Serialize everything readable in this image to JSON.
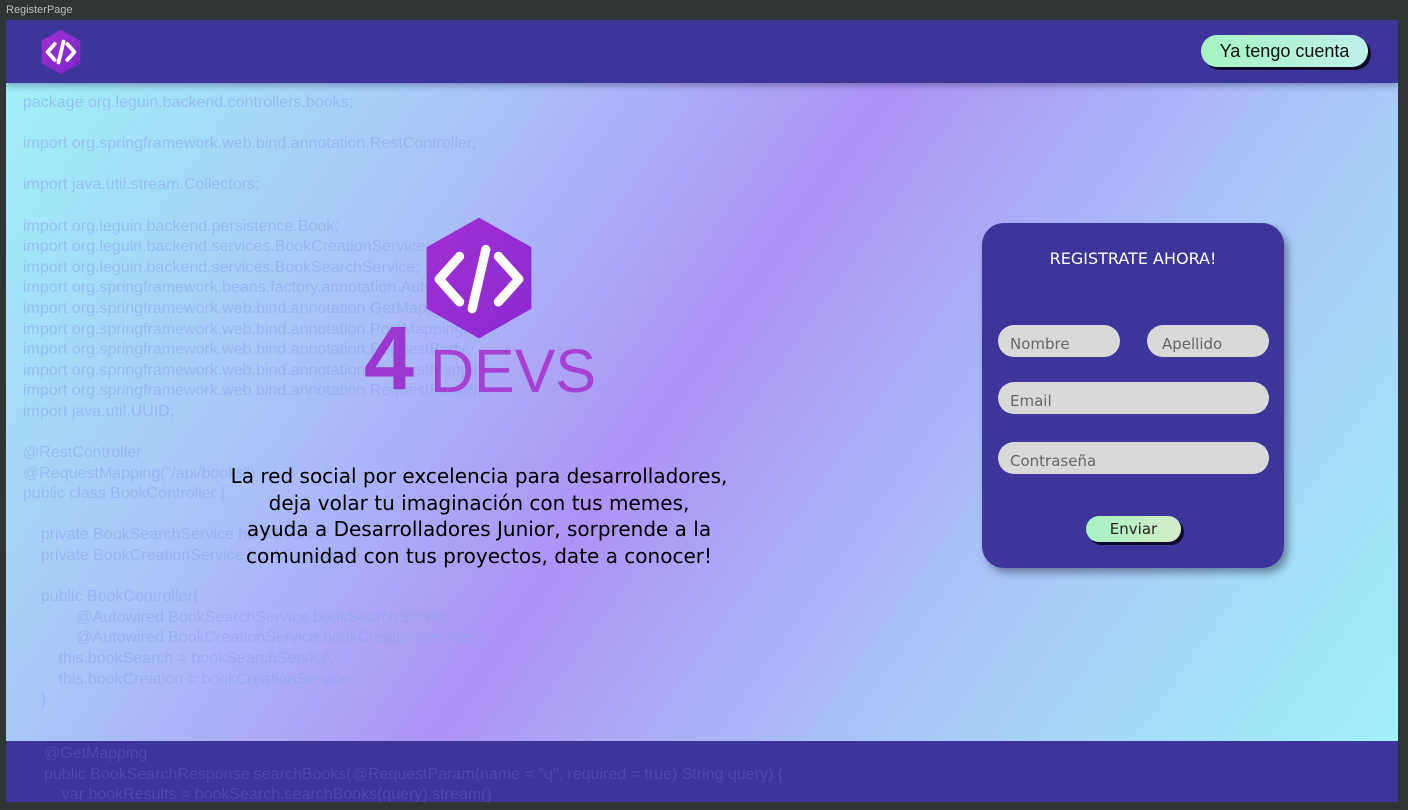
{
  "window": {
    "title": "RegisterPage"
  },
  "header": {
    "logo_icon": "code-tag-icon",
    "have_account_label": "Ya tengo cuenta"
  },
  "background_code": "package org.leguin.backend.controllers.books;\n\nimport org.springframework.web.bind.annotation.RestController;\n\nimport java.util.stream.Collectors;\n\nimport org.leguin.backend.persistence.Book;\nimport org.leguin.backend.services.BookCreationService;\nimport org.leguin.backend.services.BookSearchService;\nimport org.springframework.beans.factory.annotation.Autowired;\nimport org.springframework.web.bind.annotation.GetMapping;\nimport org.springframework.web.bind.annotation.PostMapping;\nimport org.springframework.web.bind.annotation.RequestBody;\nimport org.springframework.web.bind.annotation.RequestMapping;\nimport org.springframework.web.bind.annotation.RequestParam;\nimport java.util.UUID;\n\n@RestController\n@RequestMapping(\"/api/books\")\npublic class BookController {\n\n    private BookSearchService bookSearch;\n    private BookCreationService bookCreation;\n\n    public BookController(\n            @Autowired BookSearchService bookSearchService,\n            @Autowired BookCreationService bookCreationService) {\n        this.bookSearch = bookSearchService;\n        this.bookCreation = bookCreationService;\n    }",
  "footer_code": "@GetMapping\npublic BookSearchResponse searchBooks(@RequestParam(name = \"q\", required = true) String query) {\n    var bookResults = bookSearch.searchBooks(query).stream()",
  "hero": {
    "logo_icon": "code-tag-icon",
    "brand_number": "4",
    "brand_word": "DEVS",
    "tagline": [
      "La red social por excelencia para desarrolladores,",
      "deja volar tu imaginación con tus memes,",
      "ayuda a Desarrolladores Junior, sorprende a la",
      "comunidad con tus proyectos, date a conocer!"
    ]
  },
  "register": {
    "title": "REGISTRATE AHORA!",
    "first_name_placeholder": "Nombre",
    "last_name_placeholder": "Apellido",
    "email_placeholder": "Email",
    "password_placeholder": "Contraseña",
    "submit_label": "Enviar"
  },
  "colors": {
    "header": "#3d359a",
    "card": "#3d359a",
    "brand": "#a540d3",
    "button_mint": "#a6f2c2",
    "field": "#d9d9d9"
  }
}
